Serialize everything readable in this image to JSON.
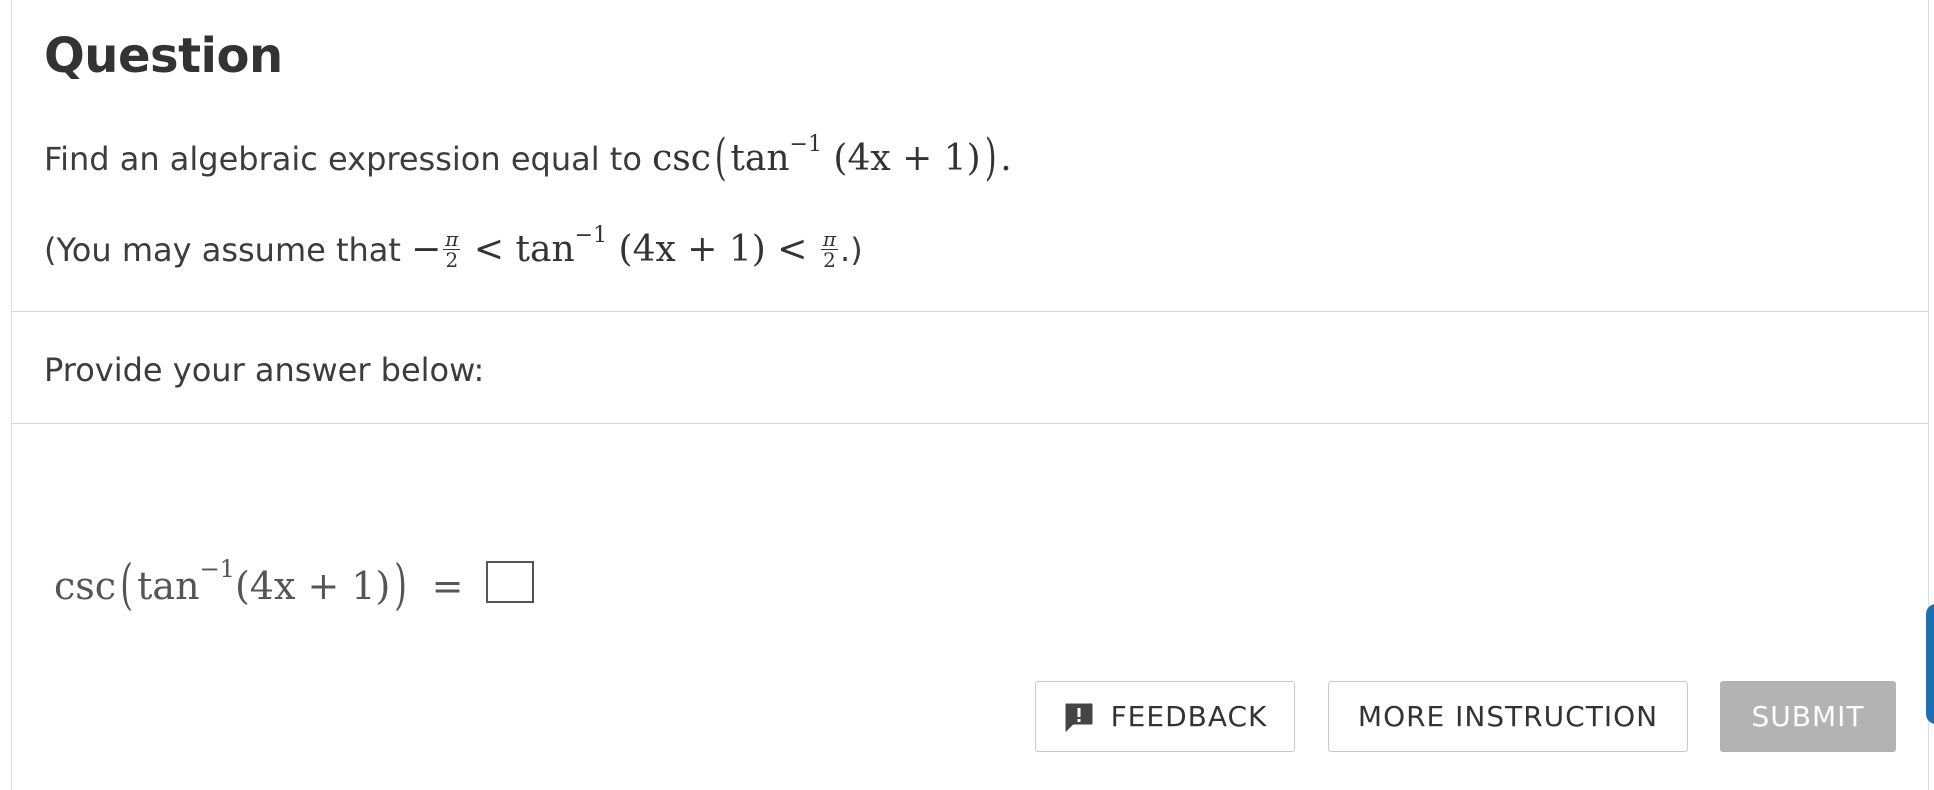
{
  "question": {
    "title": "Question",
    "prompt_text": "Find an algebraic expression equal to",
    "assume_text": "(You may assume that",
    "assume_close": ".)",
    "math_csc": "csc",
    "math_tan": "tan",
    "math_inv": "−1",
    "math_arg": "(4x + 1)",
    "math_lt": "<",
    "math_pi": "π",
    "math_two": "2",
    "math_minus": "−",
    "period": "."
  },
  "answer": {
    "instruction": "Provide your answer below:",
    "lhs_csc": "csc",
    "lhs_tan": "tan",
    "lhs_inv": "−1",
    "lhs_arg": "(4x + 1)",
    "equals": "=",
    "input_value": ""
  },
  "buttons": {
    "feedback": "FEEDBACK",
    "more_instruction": "MORE INSTRUCTION",
    "submit": "SUBMIT"
  },
  "colors": {
    "submit_bg": "#b3b3b3",
    "side_tab": "#1f6fb2"
  },
  "icons": {
    "feedback_icon": "speech-bubble-exclamation-icon"
  }
}
